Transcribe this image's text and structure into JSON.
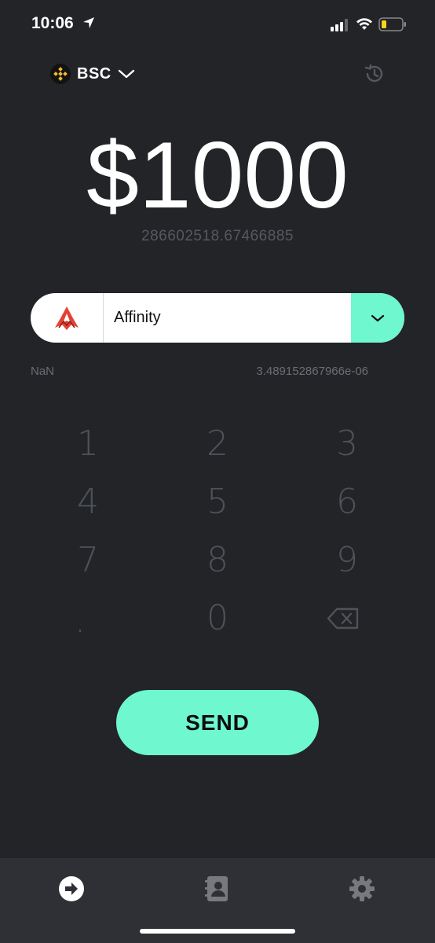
{
  "status": {
    "time": "10:06"
  },
  "network": {
    "label": "BSC",
    "icon": "bnb-icon"
  },
  "amount": {
    "value": "$1000",
    "sub": "286602518.67466885"
  },
  "token": {
    "name": "Affinity",
    "icon": "affinity-logo-icon"
  },
  "info": {
    "left": "NaN",
    "right": "3.489152867966e-06"
  },
  "keypad": {
    "keys": [
      "1",
      "2",
      "3",
      "4",
      "5",
      "6",
      "7",
      "8",
      "9",
      ".",
      "0"
    ]
  },
  "send": {
    "label": "SEND"
  },
  "tabs": [
    "send-tab",
    "contacts-tab",
    "settings-tab"
  ],
  "colors": {
    "accent": "#6ff7cf",
    "background": "#222428",
    "tabbar": "#2e3036"
  }
}
